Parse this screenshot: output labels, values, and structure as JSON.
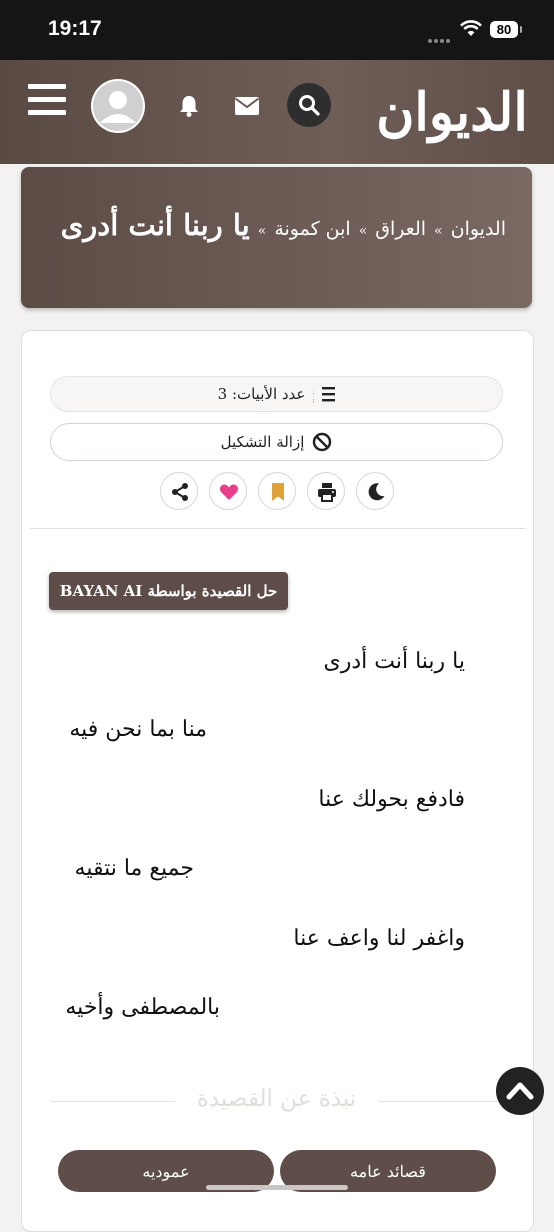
{
  "status": {
    "time": "19:17",
    "battery": "80"
  },
  "header": {
    "logo": "الديوان"
  },
  "breadcrumb": {
    "items": [
      "الديوان",
      "العراق",
      "ابن كمونة"
    ],
    "separator": "»",
    "title": "يا ربنا أنت أدرى"
  },
  "poem": {
    "verse_count_label": "عدد الأبيات: 3",
    "remove_tashkeel_label": "إزالة التشكيل",
    "bayan_label": "حل القصيدة بواسطة BAYAN AI",
    "verses": [
      [
        "يا ربنا أنت أدرى",
        "منا بما نحن فيه"
      ],
      [
        "فادفع بحولك عنا",
        "جميع ما نتقيه"
      ],
      [
        "واغفر لنا واعف عنا",
        "بالمصطفى وأخيه"
      ]
    ],
    "about_label": "نبذة عن القصيدة"
  },
  "categories": [
    "قصائد عامه",
    "عموديه"
  ],
  "icons": {
    "menu": "menu-icon",
    "avatar": "avatar-icon",
    "bell": "bell-icon",
    "mail": "mail-icon",
    "search": "search-icon",
    "share": "share-icon",
    "heart": "heart-icon",
    "bookmark": "bookmark-icon",
    "print": "print-icon",
    "dark_mode": "moon-icon",
    "scroll_top": "chevron-up-icon"
  },
  "colors": {
    "brand": "#5d4c47",
    "heart": "#e83e8c",
    "bookmark": "#e0a33a"
  }
}
